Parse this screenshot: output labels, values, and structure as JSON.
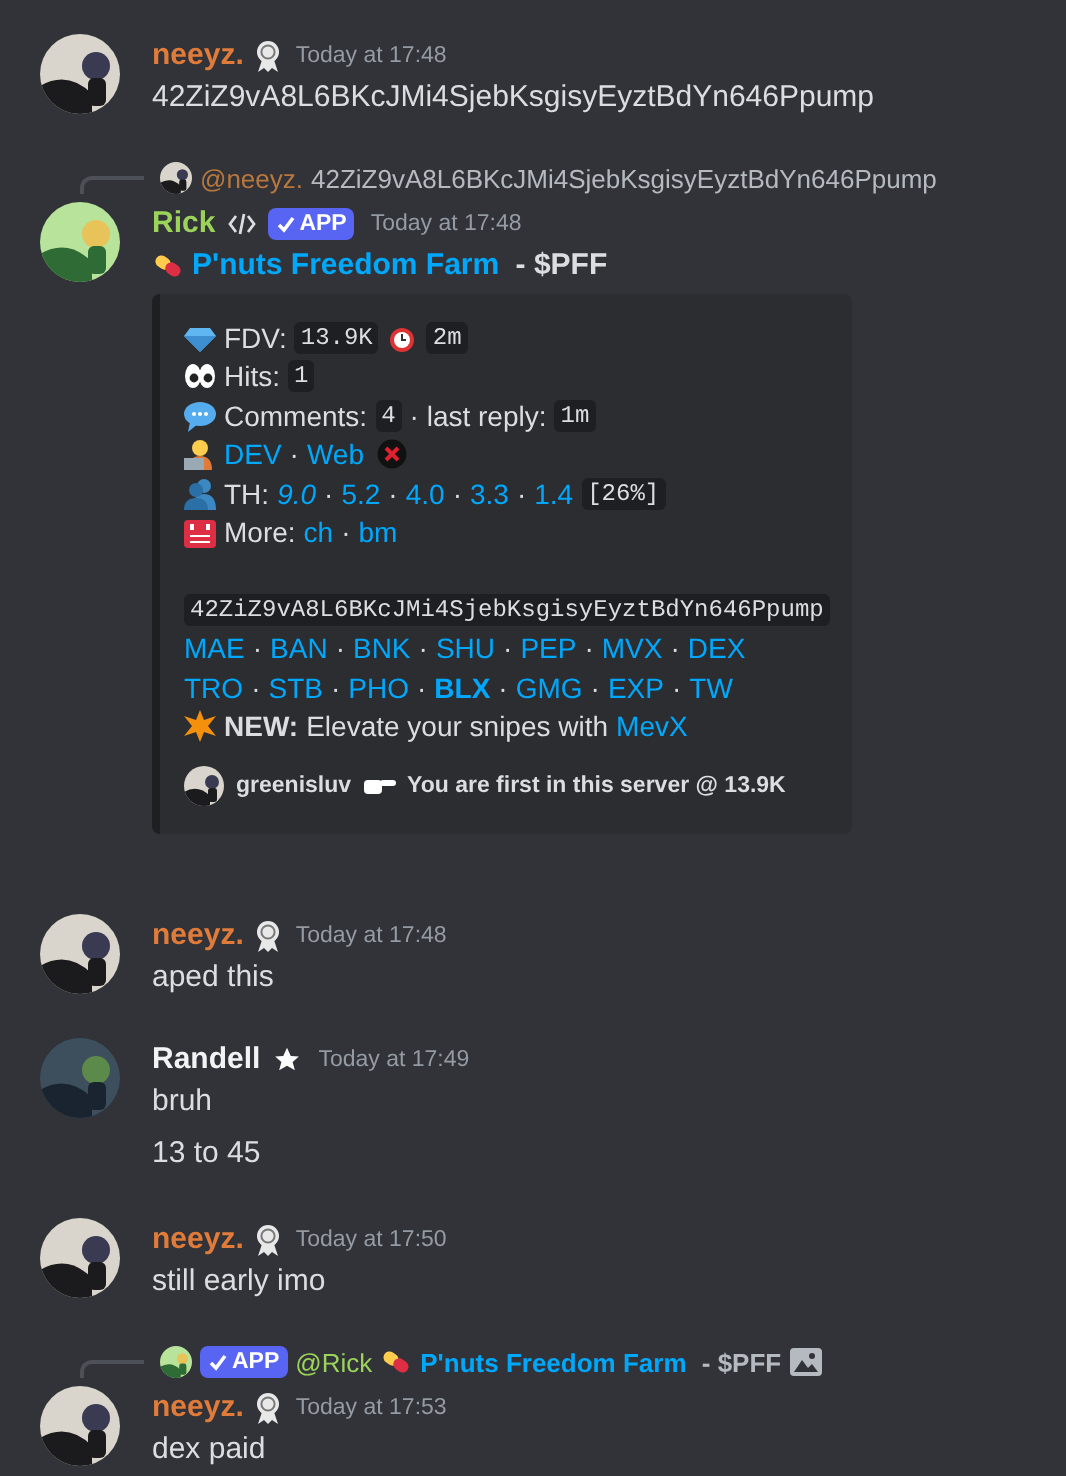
{
  "messages": [
    {
      "kind": "member",
      "author": "neeyz.",
      "color": "#e07b3a",
      "time": "Today at 17:48",
      "lines": [
        "42ZiZ9vA8L6BKcJMi4SjebKsgisyEyztBdYn646Ppump"
      ]
    },
    {
      "kind": "bot",
      "author": "Rick",
      "color": "#9bd35a",
      "app_tag": "APP",
      "time": "Today at 17:48",
      "reply": {
        "kind": "member",
        "parts": [
          {
            "kind": "mention",
            "text": "@neeyz.",
            "color": "#b8773e"
          },
          {
            "kind": "text",
            "text": "42ZiZ9vA8L6BKcJMi4SjebKsgisyEyztBdYn646Ppump"
          }
        ]
      },
      "title": {
        "link": "P'nuts Freedom Farm",
        "suffix": " - $PFF"
      },
      "embed": {
        "lines": [
          {
            "kind": "fdv",
            "parts": [
              {
                "kind": "text",
                "text": "FDV:"
              },
              {
                "kind": "code",
                "text": "13.9K"
              },
              {
                "kind": "timer"
              },
              {
                "kind": "code",
                "text": "2m"
              }
            ]
          },
          {
            "kind": "hits",
            "parts": [
              {
                "kind": "text",
                "text": "Hits:"
              },
              {
                "kind": "code",
                "text": "1"
              }
            ]
          },
          {
            "kind": "comments",
            "parts": [
              {
                "kind": "text",
                "text": "Comments:"
              },
              {
                "kind": "code",
                "text": "4"
              },
              {
                "kind": "text",
                "text": "· last reply:"
              },
              {
                "kind": "code",
                "text": "1m"
              }
            ]
          },
          {
            "kind": "dev",
            "parts": [
              {
                "kind": "links",
                "sep": "·",
                "items": [
                  {
                    "text": "DEV"
                  },
                  {
                    "text": "Web"
                  }
                ]
              },
              {
                "kind": "flag"
              }
            ]
          },
          {
            "kind": "holders",
            "parts": [
              {
                "kind": "text",
                "text": "TH:"
              },
              {
                "kind": "links",
                "sep": "·",
                "items": [
                  {
                    "text": "9.0",
                    "kind": "current"
                  },
                  {
                    "text": "5.2"
                  },
                  {
                    "text": "4.0"
                  },
                  {
                    "text": "3.3"
                  },
                  {
                    "text": "1.4"
                  }
                ]
              },
              {
                "kind": "code",
                "text": "[26%]"
              }
            ]
          },
          {
            "kind": "more",
            "parts": [
              {
                "kind": "text",
                "text": "More:"
              },
              {
                "kind": "links",
                "sep": "·",
                "items": [
                  {
                    "text": "ch"
                  },
                  {
                    "text": "bm"
                  }
                ]
              }
            ]
          },
          {
            "kind": "contract",
            "parts": [
              {
                "kind": "code",
                "text": "42ZiZ9vA8L6BKcJMi4SjebKsgisyEyztBdYn646Ppump"
              }
            ]
          },
          {
            "kind": "links",
            "parts": [
              {
                "kind": "links",
                "sep": "·",
                "items": [
                  {
                    "text": "MAE"
                  },
                  {
                    "text": "BAN"
                  },
                  {
                    "text": "BNK"
                  },
                  {
                    "text": "SHU"
                  },
                  {
                    "text": "PEP"
                  },
                  {
                    "text": "MVX"
                  },
                  {
                    "text": "DEX"
                  }
                ]
              }
            ]
          },
          {
            "kind": "links",
            "parts": [
              {
                "kind": "links",
                "sep": "·",
                "items": [
                  {
                    "text": "TRO"
                  },
                  {
                    "text": "STB"
                  },
                  {
                    "text": "PHO"
                  },
                  {
                    "text": "BLX",
                    "kind": "featured"
                  },
                  {
                    "text": "GMG"
                  },
                  {
                    "text": "EXP"
                  },
                  {
                    "text": "TW"
                  }
                ]
              }
            ]
          },
          {
            "kind": "promo",
            "parts": [
              {
                "kind": "bold",
                "text": "NEW:"
              },
              {
                "kind": "text",
                "text": "Elevate your snipes with"
              },
              {
                "kind": "link",
                "text": "MevX"
              }
            ]
          }
        ],
        "footer": {
          "name": "greenisluv",
          "text": "You are first in this server @ 13.9K"
        }
      }
    },
    {
      "kind": "member",
      "author": "neeyz.",
      "color": "#e07b3a",
      "time": "Today at 17:48",
      "lines": [
        "aped this"
      ]
    },
    {
      "kind": "booster",
      "author": "Randell",
      "color": "#f2f3f5",
      "time": "Today at 17:49",
      "lines": [
        "bruh",
        "13 to 45"
      ]
    },
    {
      "kind": "member",
      "author": "neeyz.",
      "color": "#e07b3a",
      "time": "Today at 17:50",
      "lines": [
        "still early imo"
      ]
    },
    {
      "kind": "member",
      "author": "neeyz.",
      "color": "#e07b3a",
      "time": "Today at 17:53",
      "reply": {
        "kind": "bot",
        "parts": [
          {
            "kind": "app",
            "text": "APP"
          },
          {
            "kind": "mention",
            "text": "@Rick",
            "color": "#9bd35a"
          },
          {
            "kind": "token"
          },
          {
            "kind": "link",
            "text": "P'nuts Freedom Farm"
          },
          {
            "kind": "bold",
            "text": " - $PFF"
          },
          {
            "kind": "preview"
          }
        ]
      },
      "lines": [
        "dex paid"
      ]
    }
  ]
}
